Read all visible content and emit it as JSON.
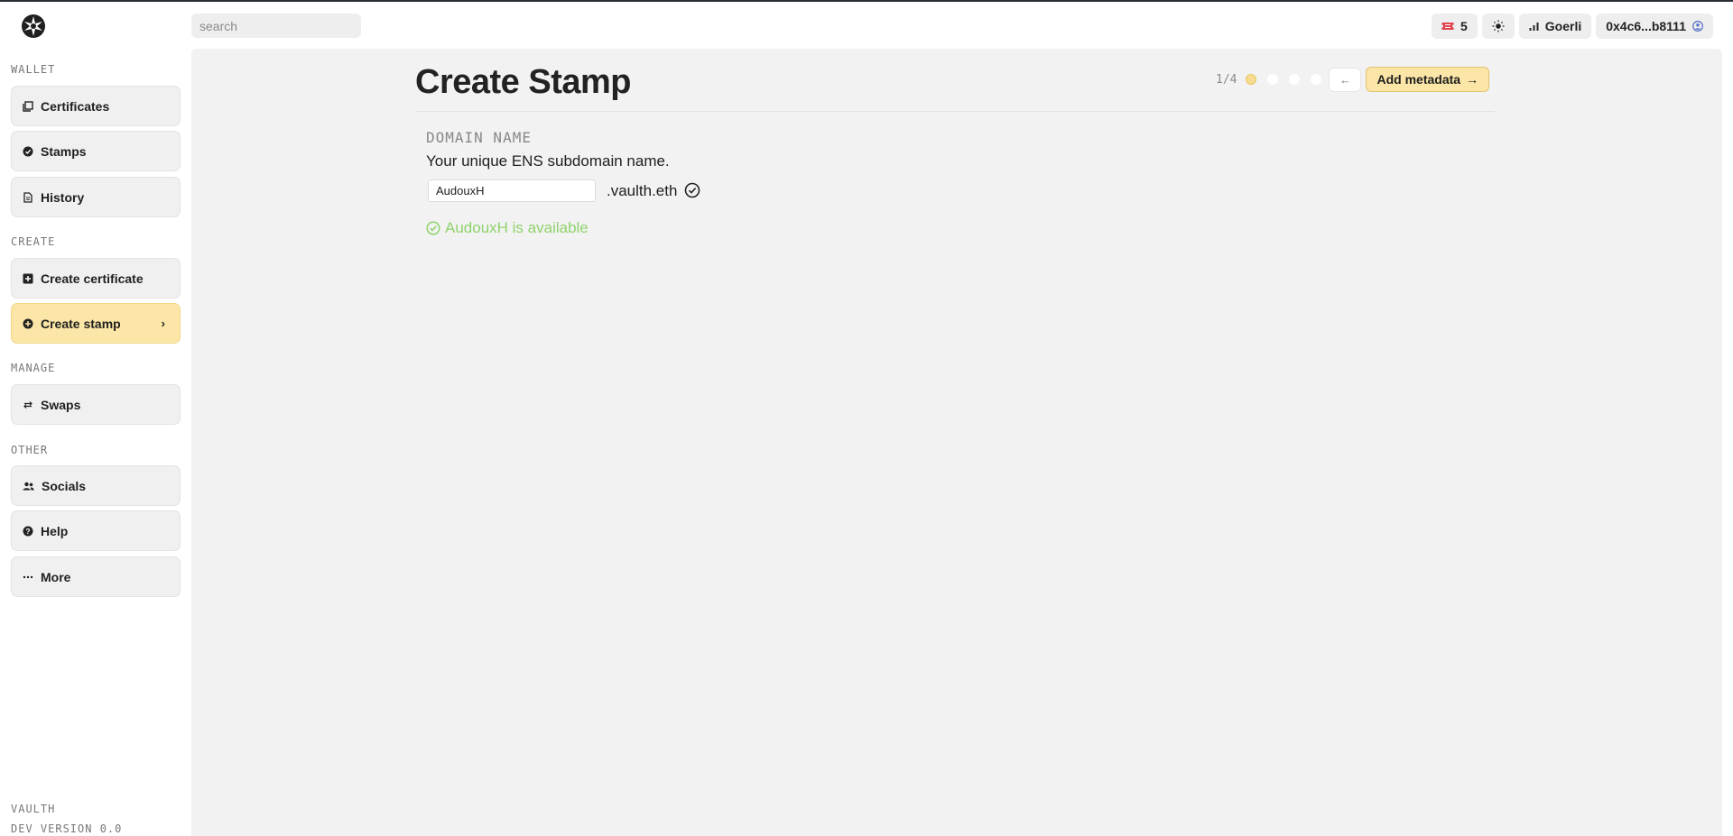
{
  "app": {
    "name": "Vaulth"
  },
  "search": {
    "placeholder": "search"
  },
  "topbar": {
    "tickets_count": "5",
    "network": "Goerli",
    "address": "0x4c6...b8111"
  },
  "sidebar": {
    "sections": {
      "wallet": "WALLET",
      "create": "CREATE",
      "manage": "MANAGE",
      "other": "OTHER"
    },
    "items": {
      "certificates": "Certificates",
      "stamps": "Stamps",
      "history": "History",
      "create_certificate": "Create certificate",
      "create_stamp": "Create stamp",
      "swaps": "Swaps",
      "socials": "Socials",
      "help": "Help",
      "more": "More"
    },
    "active_chevron": "›",
    "footer": {
      "app": "VAULTH",
      "version": "DEV VERSION 0.0"
    }
  },
  "main": {
    "title": "Create Stamp",
    "stepper": {
      "count": "1/4",
      "current": 1,
      "total": 4
    },
    "back_label": "←",
    "next_label": "Add metadata",
    "next_arrow": "→",
    "field": {
      "label": "DOMAIN NAME",
      "description": "Your unique ENS subdomain name.",
      "value": "AudouxH",
      "suffix": ".vaulth.eth"
    },
    "availability": "AudouxH is available"
  },
  "colors": {
    "accent": "#fbe6a7",
    "success": "#8fd36c",
    "ticket": "#e0454f",
    "address_icon": "#5b76c9"
  }
}
